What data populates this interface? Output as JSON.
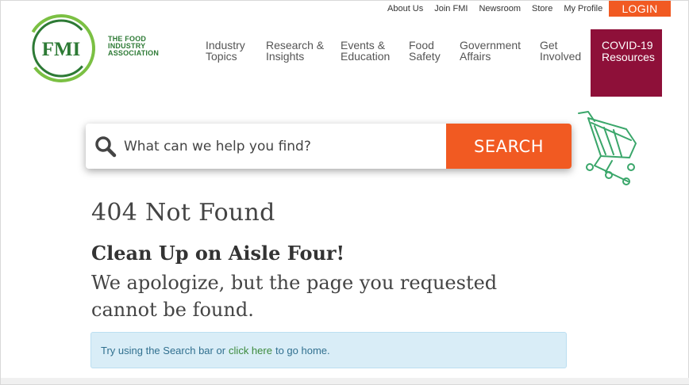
{
  "colors": {
    "accent": "#f15a22",
    "brand_green": "#2d7a35",
    "covid_bg": "#8e1039",
    "hint_bg": "#d9edf7"
  },
  "utility_nav": [
    "About Us",
    "Join FMI",
    "Newsroom",
    "Store",
    "My Profile"
  ],
  "login_label": "LOGIN",
  "logo": {
    "mark": "FMI",
    "text": "THE FOOD\nINDUSTRY\nASSOCIATION"
  },
  "main_nav": {
    "industry": "Industry\nTopics",
    "research": "Research &\nInsights",
    "events": "Events &\nEducation",
    "food_safety": "Food\nSafety",
    "government": "Government\nAffairs",
    "involved": "Get\nInvolved",
    "covid": "COVID-19\nResources"
  },
  "search": {
    "placeholder": "What can we help you find?",
    "button": "SEARCH"
  },
  "content": {
    "title": "404 Not Found",
    "subhead": "Clean Up on Aisle Four!",
    "apology": "We apologize, but the page you requested cannot be found.",
    "hint_before": "Try using the Search bar or",
    "hint_link": "click here",
    "hint_after": "to go home."
  },
  "icons": {
    "search": "search-icon",
    "cart": "shopping-cart-icon"
  }
}
